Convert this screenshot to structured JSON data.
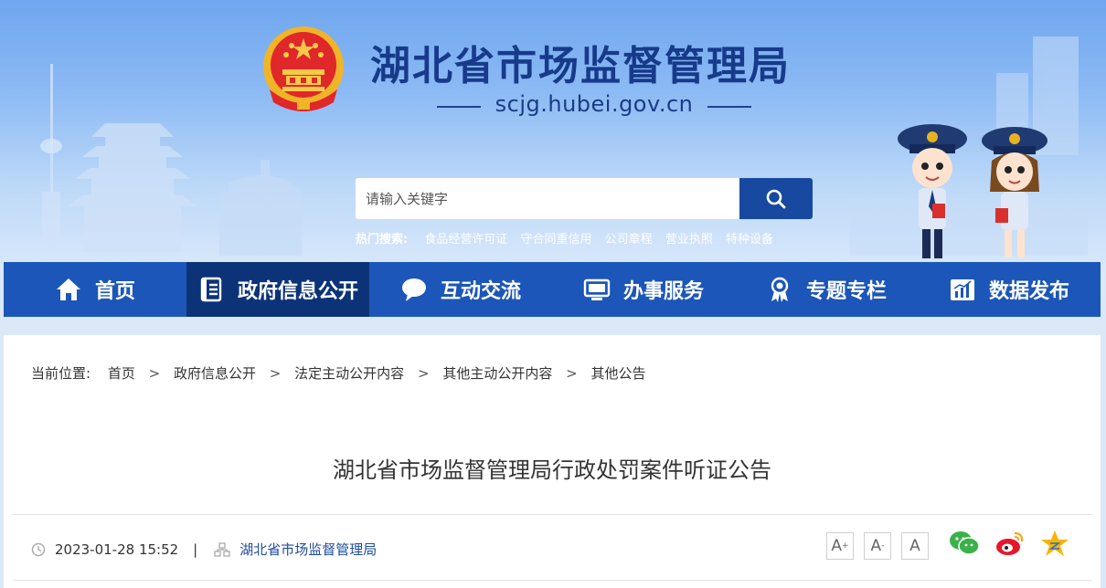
{
  "header": {
    "site_title": "湖北省市场监督管理局",
    "site_domain": "scjg.hubei.gov.cn"
  },
  "search": {
    "placeholder": "请输入关键字",
    "hot_label": "热门搜索:",
    "hot_terms": [
      "食品经营许可证",
      "守合同重信用",
      "公司章程",
      "营业执照",
      "特种设备"
    ]
  },
  "nav": {
    "items": [
      {
        "label": "首页",
        "icon": "home-icon",
        "active": false
      },
      {
        "label": "政府信息公开",
        "icon": "document-icon",
        "active": true
      },
      {
        "label": "互动交流",
        "icon": "chat-bubble-icon",
        "active": false
      },
      {
        "label": "办事服务",
        "icon": "monitor-icon",
        "active": false
      },
      {
        "label": "专题专栏",
        "icon": "award-ribbon-icon",
        "active": false
      },
      {
        "label": "数据发布",
        "icon": "bar-chart-icon",
        "active": false
      }
    ]
  },
  "breadcrumb": {
    "label": "当前位置:",
    "items": [
      "首页",
      "政府信息公开",
      "法定主动公开内容",
      "其他主动公开内容",
      "其他公告"
    ],
    "separator": ">"
  },
  "article": {
    "title": "湖北省市场监督管理局行政处罚案件听证公告",
    "datetime": "2023-01-28 15:52",
    "meta_separator": "|",
    "source": "湖北省市场监督管理局"
  },
  "font_controls": {
    "increase": "A",
    "decrease": "A",
    "reset": "A",
    "increase_mark": "+",
    "decrease_mark": "-"
  },
  "share": [
    "wechat-icon",
    "weibo-icon",
    "qzone-star-icon"
  ],
  "colors": {
    "nav_bg": "#1c56b8",
    "nav_active": "#0c3377",
    "title_blue": "#173a8a",
    "search_button": "#1749a0"
  }
}
